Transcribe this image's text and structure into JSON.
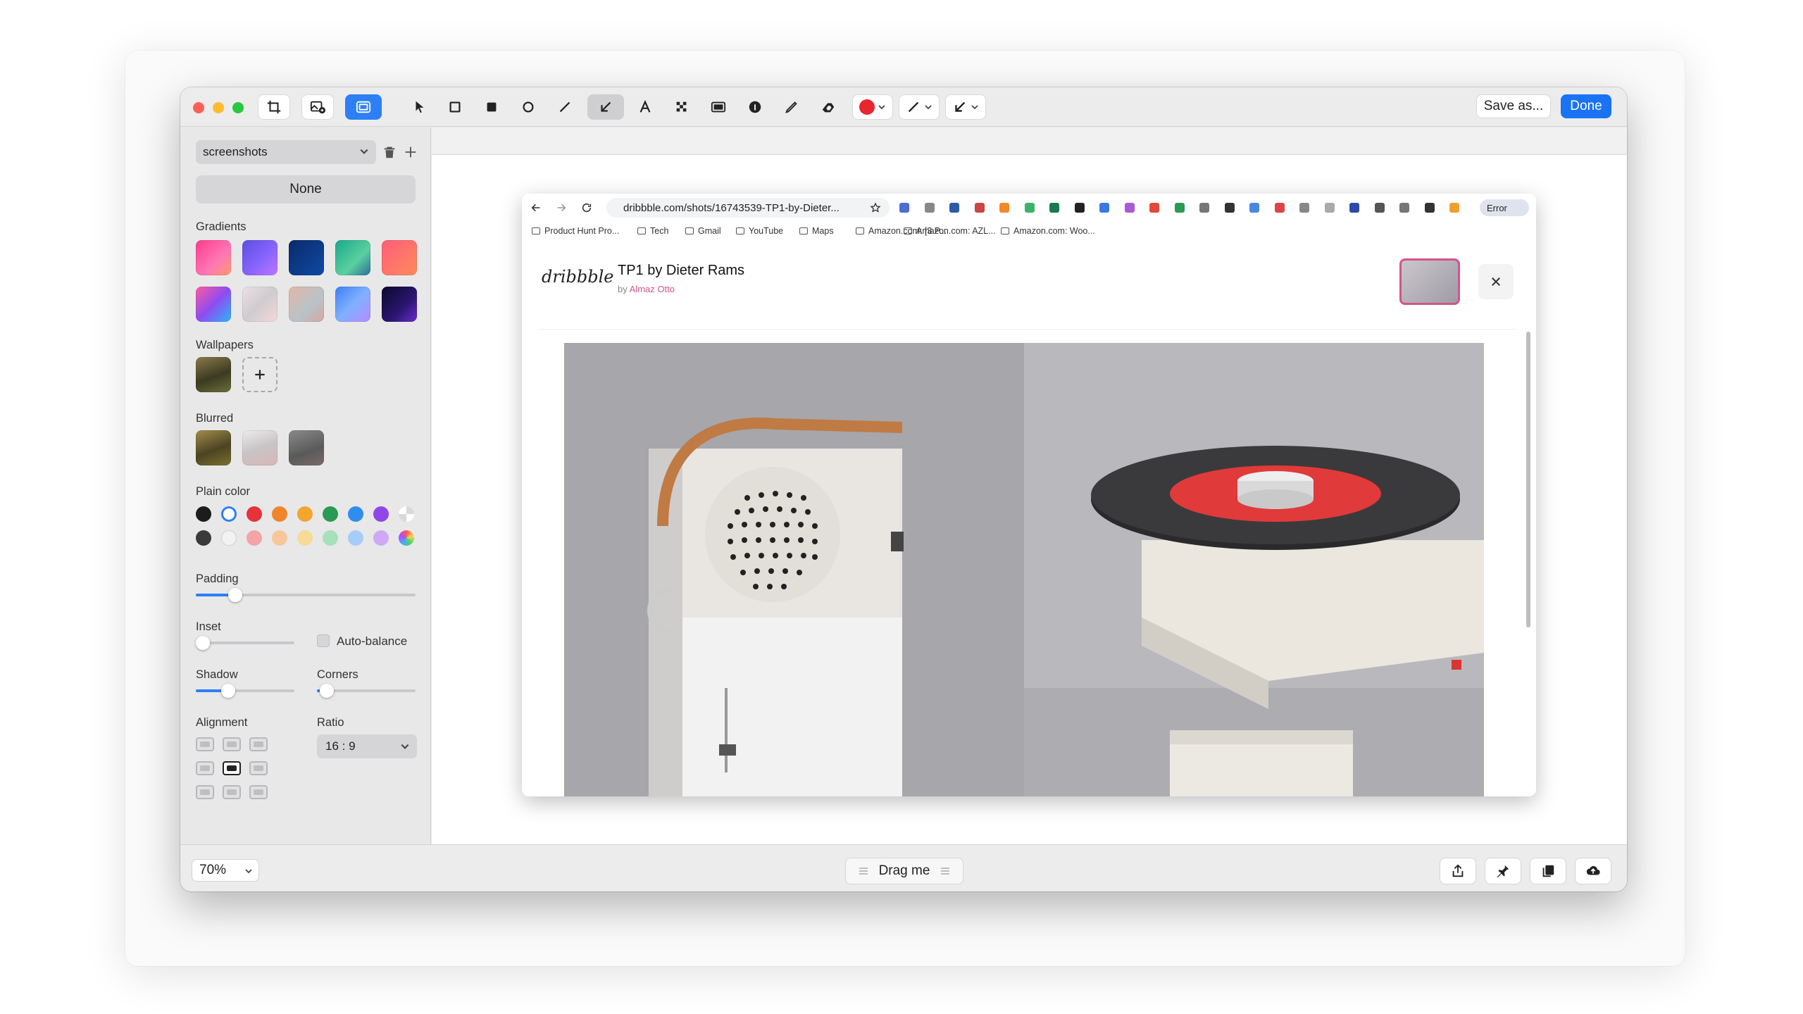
{
  "toolbar": {
    "save_label": "Save as...",
    "done_label": "Done",
    "tools": [
      "crop-icon",
      "image-add-icon",
      "background-icon",
      "arrow-pointer-icon",
      "rectangle-icon",
      "filled-rectangle-icon",
      "ellipse-icon",
      "line-icon",
      "arrow-icon",
      "text-icon",
      "pixelate-icon",
      "highlight-icon",
      "counter-icon",
      "pen-icon",
      "eraser-icon"
    ],
    "color": "#e8262d"
  },
  "sidebar": {
    "preset": "screenshots",
    "none_label": "None",
    "gradients_label": "Gradients",
    "wallpapers_label": "Wallpapers",
    "blurred_label": "Blurred",
    "plain_label": "Plain color",
    "padding_label": "Padding",
    "inset_label": "Inset",
    "autobalance_label": "Auto-balance",
    "shadow_label": "Shadow",
    "corners_label": "Corners",
    "alignment_label": "Alignment",
    "ratio_label": "Ratio",
    "ratio_value": "16 : 9",
    "padding_value": 0.18,
    "inset_value": 0.0,
    "shadow_value": 0.33,
    "corners_value": 0.1,
    "plain_colors": [
      "#1c1c1c",
      "#ffffff",
      "#e6323a",
      "#f0852b",
      "#f3a530",
      "#2a9a55",
      "#2f8df0",
      "#9147e8",
      "#3a3a3a",
      "#f2f2f2",
      "#f5a3a6",
      "#f7c79b",
      "#f7da95",
      "#a7e0b9",
      "#a6cdf8",
      "#cfa9f6"
    ]
  },
  "browser": {
    "url": "dribbble.com/shots/16743539-TP1-by-Dieter...",
    "error_label": "Error",
    "bookmarks": [
      "Product Hunt Pro...",
      "Tech",
      "Gmail",
      "YouTube",
      "Maps",
      "Amazon.com: [3 P...",
      "Amazon.com: AZL...",
      "Amazon.com: Woo..."
    ],
    "logo": "dribbble",
    "shot_title": "TP1 by Dieter Rams",
    "shot_by": "by",
    "shot_author": "Almaz Otto"
  },
  "bottom": {
    "zoom": "70%",
    "drag_label": "Drag me"
  }
}
